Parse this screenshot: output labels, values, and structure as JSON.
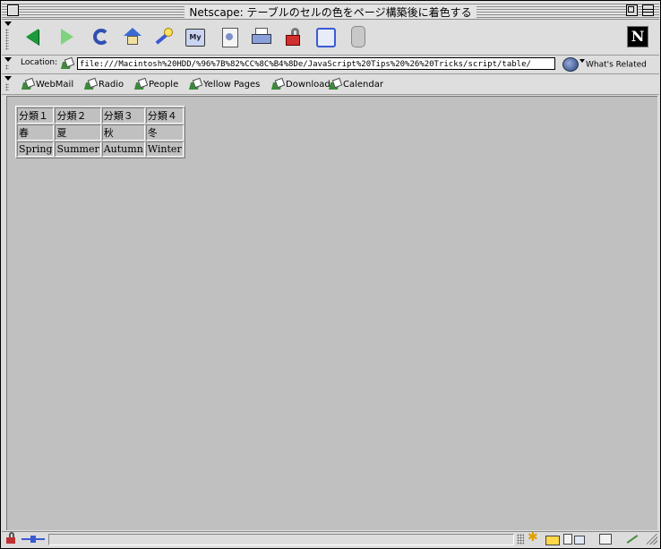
{
  "window": {
    "title": "Netscape: テーブルのセルの色をページ構築後に着色する"
  },
  "navigation_toolbar": {
    "buttons": [
      {
        "name": "back-icon"
      },
      {
        "name": "forward-icon"
      },
      {
        "name": "reload-icon"
      },
      {
        "name": "home-icon"
      },
      {
        "name": "search-icon"
      },
      {
        "name": "my-netscape-icon",
        "glyph": "My"
      },
      {
        "name": "images-icon"
      },
      {
        "name": "print-icon"
      },
      {
        "name": "security-icon"
      },
      {
        "name": "shop-icon"
      },
      {
        "name": "stop-icon"
      }
    ],
    "logo_letter": "N"
  },
  "location_bar": {
    "label": "Location:",
    "url": "file:///Macintosh%20HDD/%96%7B%82%CC%8C%B4%8De/JavaScript%20Tips%20%26%20Tricks/script/table/",
    "whats_related": "What's Related"
  },
  "bookmarks": [
    "WebMail",
    "Radio",
    "People",
    "Yellow Pages",
    "Download",
    "Calendar"
  ],
  "table": {
    "rows": [
      [
        "分類１",
        "分類２",
        "分類３",
        "分類４"
      ],
      [
        "春",
        "夏",
        "秋",
        "冬"
      ],
      [
        "Spring",
        "Summer",
        "Autumn",
        "Winter"
      ]
    ]
  },
  "colors": {
    "page_background": "#c0c0c0",
    "chrome": "#dedede"
  }
}
